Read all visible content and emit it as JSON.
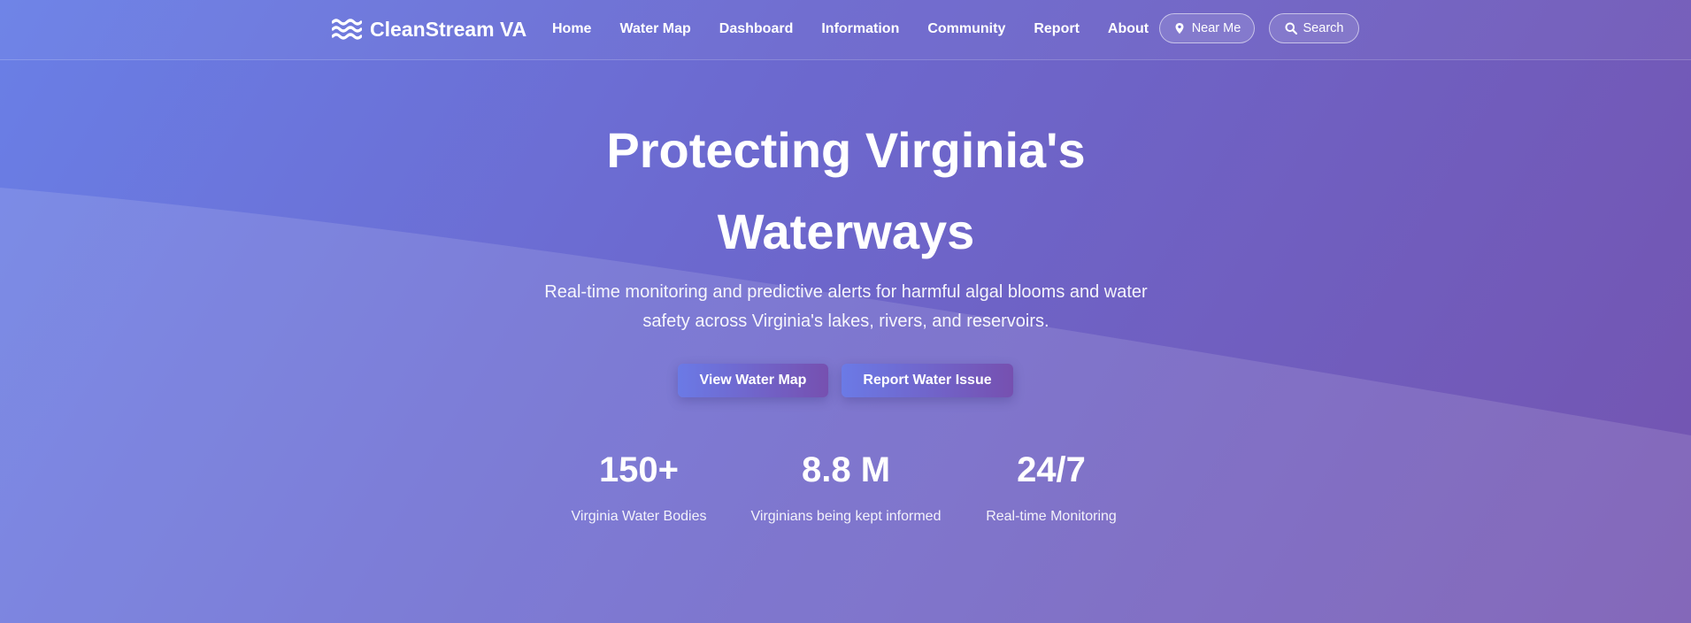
{
  "brand": {
    "name": "CleanStream VA",
    "icon": "waves-icon"
  },
  "nav": {
    "links": [
      "Home",
      "Water Map",
      "Dashboard",
      "Information",
      "Community",
      "Report",
      "About"
    ],
    "near_me": {
      "label": "Near Me",
      "icon": "map-pin-icon"
    },
    "search": {
      "label": "Search",
      "icon": "search-icon"
    }
  },
  "hero": {
    "title_line1": "Protecting Virginia's",
    "title_line2": "Waterways",
    "subtitle": "Real-time monitoring and predictive alerts for harmful algal blooms and water safety across Virginia's lakes, rivers, and reservoirs.",
    "primary_button": "View Water Map",
    "secondary_button": "Report Water Issue"
  },
  "stats": [
    {
      "value": "150+",
      "label": "Virginia Water Bodies"
    },
    {
      "value": "8.8 M",
      "label": "Virginians being kept informed"
    },
    {
      "value": "24/7",
      "label": "Real-time Monitoring"
    }
  ],
  "colors": {
    "gradient_start": "#6a7fe6",
    "gradient_end": "#7454b0",
    "text": "#ffffff"
  }
}
